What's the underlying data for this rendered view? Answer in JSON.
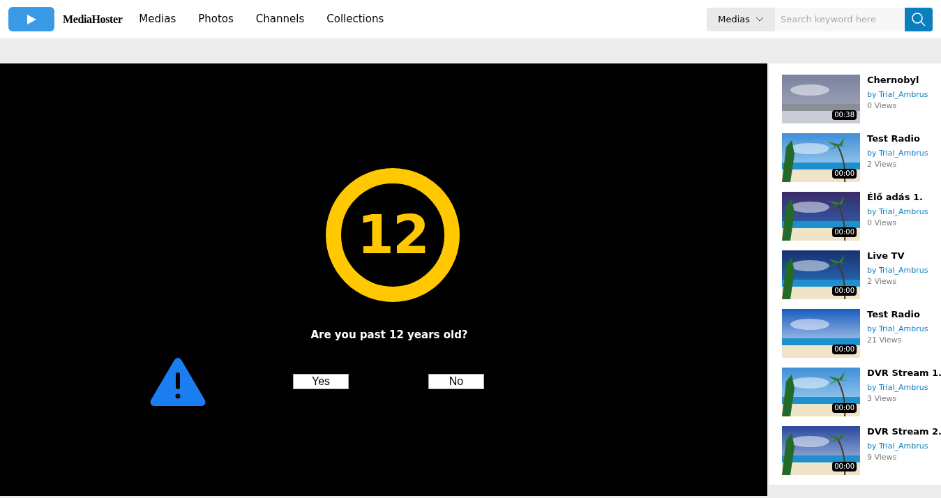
{
  "header": {
    "logo_text": "MediaHoster",
    "nav": [
      {
        "label": "Medias"
      },
      {
        "label": "Photos"
      },
      {
        "label": "Channels"
      },
      {
        "label": "Collections"
      }
    ],
    "search": {
      "category": "Medias",
      "placeholder": "Search keyword here"
    }
  },
  "player": {
    "rating": "12",
    "question": "Are you past 12 years old?",
    "buttons": [
      "Yes",
      "No"
    ]
  },
  "sidebar": {
    "videos": [
      {
        "title": "Chernobyl",
        "author": "by Trial_Ambrus",
        "views": "0 Views",
        "duration": "00:38"
      },
      {
        "title": "Test Radio",
        "author": "by Trial_Ambrus",
        "views": "2 Views",
        "duration": "00:00"
      },
      {
        "title": "Élő adás 1.",
        "author": "by Trial_Ambrus",
        "views": "0 Views",
        "duration": "00:00"
      },
      {
        "title": "Live TV",
        "author": "by Trial_Ambrus",
        "views": "2 Views",
        "duration": "00:00"
      },
      {
        "title": "Test Radio",
        "author": "by Trial_Ambrus",
        "views": "21 Views",
        "duration": "00:00"
      },
      {
        "title": "DVR Stream 1.",
        "author": "by Trial_Ambrus",
        "views": "3 Views",
        "duration": "00:00"
      },
      {
        "title": "DVR Stream 2.",
        "author": "by Trial_Ambrus",
        "views": "9 Views",
        "duration": "00:00"
      }
    ]
  }
}
